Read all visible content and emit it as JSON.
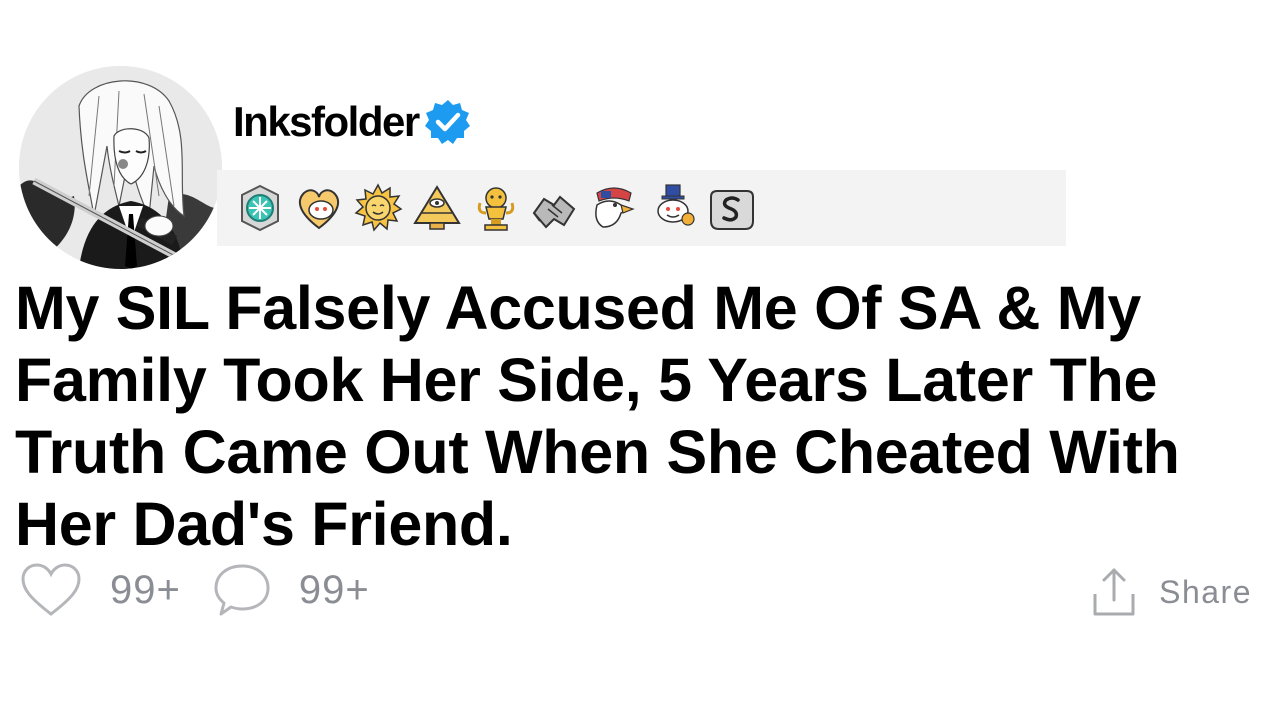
{
  "author": {
    "username": "Inksfolder",
    "verified": true,
    "avatar_icon": "anime-swordsman-avatar"
  },
  "awards": [
    {
      "icon": "teal-gem-badge-award-icon"
    },
    {
      "icon": "heart-snoo-award-icon"
    },
    {
      "icon": "sun-face-award-icon"
    },
    {
      "icon": "pyramid-eye-award-icon"
    },
    {
      "icon": "gold-trophy-award-icon"
    },
    {
      "icon": "handshake-award-icon"
    },
    {
      "icon": "eagle-flag-award-icon"
    },
    {
      "icon": "snoo-top-hat-award-icon"
    },
    {
      "icon": "silver-s-coin-award-icon"
    }
  ],
  "post": {
    "title": "My SIL Falsely Accused Me Of SA & My Family Took Her Side, 5 Years Later The Truth Came Out When She Cheated With Her Dad's Friend."
  },
  "actions": {
    "likes": "99+",
    "comments": "99+",
    "share_label": "Share"
  },
  "colors": {
    "verified_blue": "#1d9bf0",
    "muted_gray": "#8a8d93",
    "award_strip_bg": "#f3f3f3"
  }
}
